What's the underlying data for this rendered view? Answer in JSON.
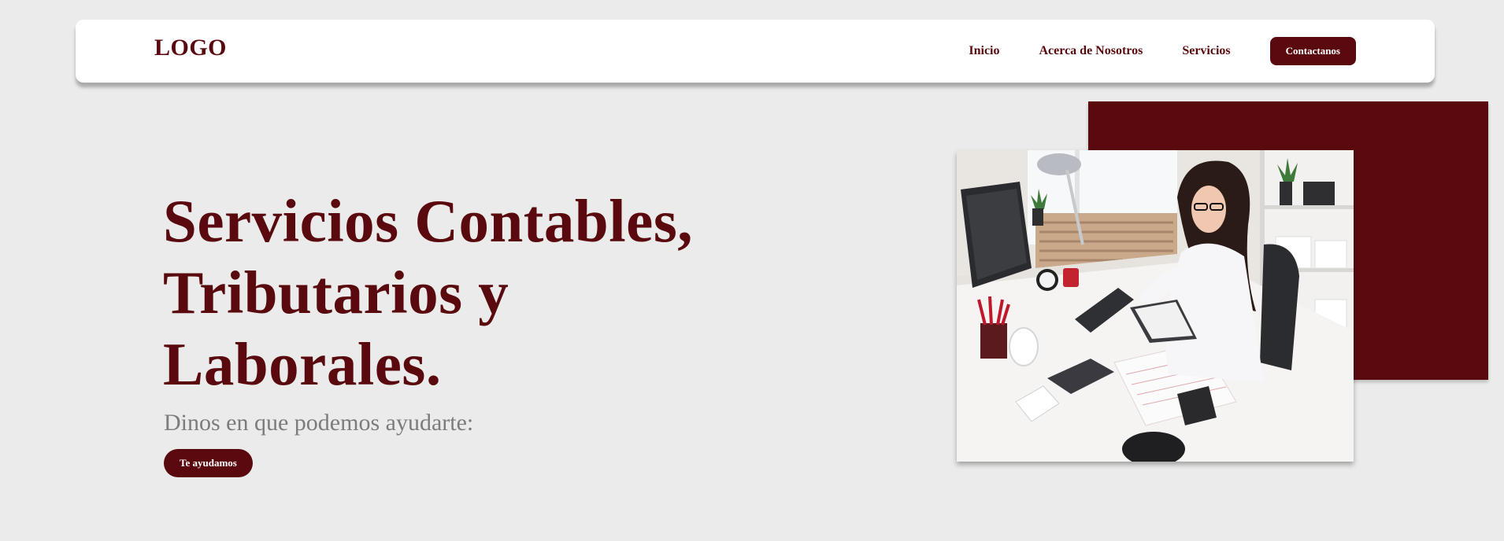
{
  "header": {
    "logo": "LOGO",
    "nav": [
      {
        "label": "Inicio"
      },
      {
        "label": "Acerca de Nosotros"
      },
      {
        "label": "Servicios"
      }
    ],
    "cta_label": "Contactanos"
  },
  "hero": {
    "title_lines": [
      "Servicios Contables,",
      "Tributarios y",
      "Laborales."
    ],
    "subtitle": "Dinos en que podemos ayudarte:",
    "button_label": "Te ayudamos",
    "photo_alt": "woman-working-at-office-desk"
  },
  "colors": {
    "brand": "#5a0a0e",
    "background": "#eaebea",
    "surface": "#ffffff",
    "muted_text": "#7c7c7c"
  }
}
